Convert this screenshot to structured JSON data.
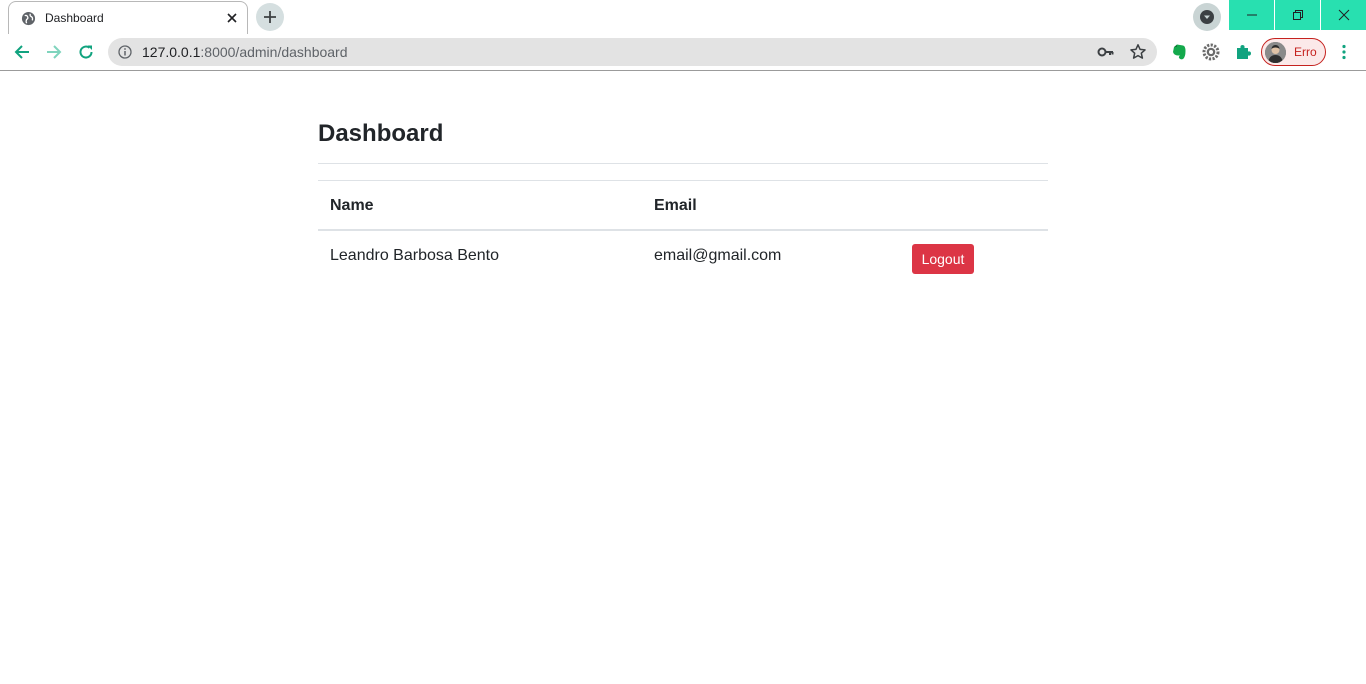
{
  "browser": {
    "tab": {
      "title": "Dashboard"
    },
    "address_bar": {
      "host": "127.0.0.1",
      "path": ":8000/admin/dashboard"
    },
    "profile": {
      "label": "Erro"
    },
    "colors": {
      "accent": "#28e0b0",
      "error": "#c5221f"
    }
  },
  "page": {
    "title": "Dashboard",
    "table": {
      "headers": {
        "name": "Name",
        "email": "Email"
      },
      "rows": [
        {
          "name": "Leandro Barbosa Bento",
          "email": "email@gmail.com",
          "action": "Logout"
        }
      ]
    },
    "colors": {
      "danger": "#dc3545"
    }
  }
}
